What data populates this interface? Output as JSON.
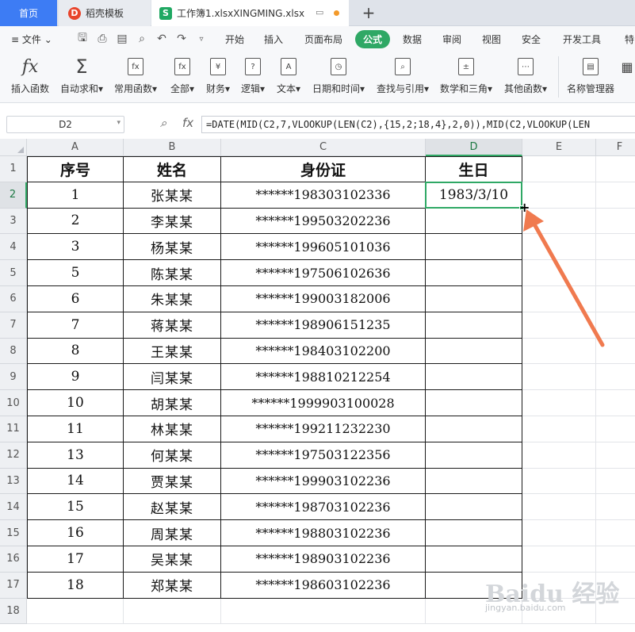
{
  "tabs": {
    "home": "首页",
    "template": "稻壳模板",
    "file": "工作簿1.xlsxXINGMING.xlsx",
    "template_icon_glyph": "D",
    "file_icon_glyph": "S",
    "new_tab": "+"
  },
  "menu": {
    "file": "文件",
    "items": [
      "开始",
      "插入",
      "页面布局",
      "公式",
      "数据",
      "审阅",
      "视图",
      "安全",
      "开发工具",
      "特"
    ],
    "active": "公式",
    "quick_access_icons": [
      "save-icon",
      "print-preview-icon",
      "print-icon",
      "find-icon",
      "undo-icon",
      "redo-icon",
      "more-icon"
    ]
  },
  "ribbon": {
    "buttons": [
      {
        "label": "插入函数",
        "icon": "fx"
      },
      {
        "label": "自动求和",
        "icon": "Σ",
        "dropdown": true
      },
      {
        "label": "常用函数",
        "icon": "fx",
        "dropdown": true
      },
      {
        "label": "全部",
        "icon": "fx",
        "dropdown": true
      },
      {
        "label": "财务",
        "icon": "¥",
        "dropdown": true
      },
      {
        "label": "逻辑",
        "icon": "?",
        "dropdown": true
      },
      {
        "label": "文本",
        "icon": "A",
        "dropdown": true
      },
      {
        "label": "日期和时间",
        "icon": "◷",
        "dropdown": true
      },
      {
        "label": "查找与引用",
        "icon": "⌕",
        "dropdown": true
      },
      {
        "label": "数学和三角",
        "icon": "±",
        "dropdown": true
      },
      {
        "label": "其他函数",
        "icon": "⋯",
        "dropdown": true
      },
      {
        "label": "名称管理器",
        "icon": "▤"
      }
    ]
  },
  "formula_bar": {
    "name_box": "D2",
    "fx": "fx",
    "formula": "=DATE(MID(C2,7,VLOOKUP(LEN(C2),{15,2;18,4},2,0)),MID(C2,VLOOKUP(LEN"
  },
  "sheet": {
    "columns": [
      "A",
      "B",
      "C",
      "D",
      "E",
      "F"
    ],
    "selected_column": "D",
    "selected_row": 2,
    "row_numbers": [
      1,
      2,
      3,
      4,
      5,
      6,
      7,
      8,
      9,
      10,
      11,
      12,
      13,
      14,
      15,
      16,
      17,
      18
    ],
    "header": [
      "序号",
      "姓名",
      "身份证",
      "生日"
    ],
    "rows": [
      [
        "1",
        "张某某",
        "******198303102336",
        "1983/3/10"
      ],
      [
        "2",
        "李某某",
        "******199503202236",
        ""
      ],
      [
        "3",
        "杨某某",
        "******199605101036",
        ""
      ],
      [
        "5",
        "陈某某",
        "******197506102636",
        ""
      ],
      [
        "6",
        "朱某某",
        "******199003182006",
        ""
      ],
      [
        "7",
        "蒋某某",
        "******198906151235",
        ""
      ],
      [
        "8",
        "王某某",
        "******198403102200",
        ""
      ],
      [
        "9",
        "闫某某",
        "******198810212254",
        ""
      ],
      [
        "10",
        "胡某某",
        "******1999903100028",
        ""
      ],
      [
        "11",
        "林某某",
        "******199211232230",
        ""
      ],
      [
        "13",
        "何某某",
        "******197503122356",
        ""
      ],
      [
        "14",
        "贾某某",
        "******199903102236",
        ""
      ],
      [
        "15",
        "赵某某",
        "******198703102236",
        ""
      ],
      [
        "16",
        "周某某",
        "******198803102236",
        ""
      ],
      [
        "17",
        "吴某某",
        "******198903102236",
        ""
      ],
      [
        "18",
        "郑某某",
        "******198603102236",
        ""
      ]
    ]
  },
  "colors": {
    "accent_green": "#2fa865",
    "tab_blue": "#3d7cf4",
    "arrow": "#f07a4f"
  },
  "watermark": {
    "logo": "Baidu 经验",
    "url": "jingyan.baidu.com"
  }
}
